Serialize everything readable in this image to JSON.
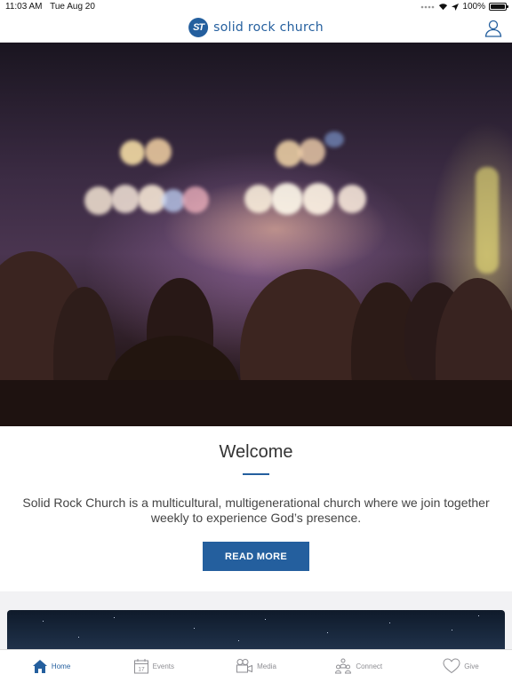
{
  "status_bar": {
    "time": "11:03 AM",
    "date": "Tue Aug 20",
    "battery": "100%",
    "battery_level": 1.0
  },
  "header": {
    "logo_mark": "ST",
    "brand_name": "solid rock church"
  },
  "welcome": {
    "title": "Welcome",
    "text": "Solid Rock Church is a multicultural, multigenerational church where we join together weekly to experience God’s presence.",
    "button_label": "READ MORE"
  },
  "tabs": [
    {
      "label": "Home",
      "icon": "home-icon",
      "active": true
    },
    {
      "label": "Events",
      "icon": "calendar-icon",
      "calendar_day": "17",
      "active": false
    },
    {
      "label": "Media",
      "icon": "video-camera-icon",
      "active": false
    },
    {
      "label": "Connect",
      "icon": "people-icon",
      "active": false
    },
    {
      "label": "Give",
      "icon": "heart-icon",
      "active": false
    }
  ],
  "colors": {
    "accent": "#245f9e",
    "inactive": "#8e8e93"
  }
}
